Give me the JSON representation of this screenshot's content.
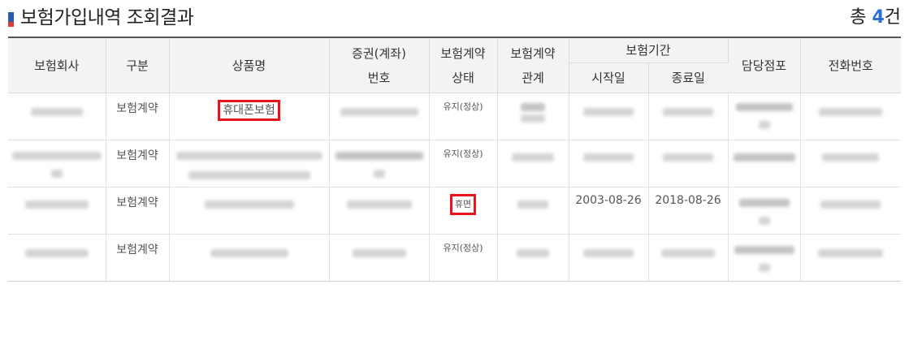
{
  "header": {
    "title": "보험가입내역 조회결과",
    "total_prefix": "총 ",
    "total_count": "4",
    "total_suffix": "건"
  },
  "table": {
    "columns": {
      "company": "보험회사",
      "category": "구분",
      "product": "상품명",
      "policy_no_line1": "증권(계좌)",
      "policy_no_line2": "번호",
      "contract_status_line1": "보험계약",
      "contract_status_line2": "상태",
      "contract_relation_line1": "보험계약",
      "contract_relation_line2": "관계",
      "period": "보험기간",
      "start_date": "시작일",
      "end_date": "종료일",
      "branch": "담당점포",
      "phone": "전화번호"
    },
    "rows": [
      {
        "category": "보험계약",
        "product": "휴대폰보험",
        "status": "유지(정상)",
        "start": "",
        "end": ""
      },
      {
        "category": "보험계약",
        "product": "",
        "status": "유지(정상)",
        "start": "",
        "end": ""
      },
      {
        "category": "보험계약",
        "product": "",
        "status": "휴면",
        "start": "2003-08-26",
        "end": "2018-08-26"
      },
      {
        "category": "보험계약",
        "product": "",
        "status": "유지(정상)",
        "start": "",
        "end": ""
      }
    ]
  }
}
